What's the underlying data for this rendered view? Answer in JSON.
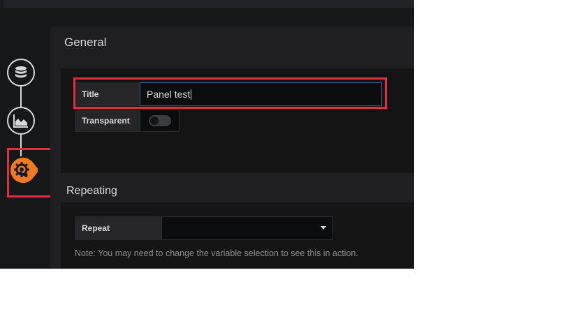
{
  "general": {
    "title": "General",
    "title_label": "Title",
    "title_value": "Panel test",
    "transparent_label": "Transparent",
    "transparent_on": false
  },
  "repeating": {
    "title": "Repeating",
    "repeat_label": "Repeat",
    "repeat_value": "",
    "note": "Note: You may need to change the variable selection to see this in action."
  },
  "steps": [
    {
      "icon": "database-icon",
      "active": false
    },
    {
      "icon": "area-chart-icon",
      "active": false
    },
    {
      "icon": "settings-wrench-icon",
      "active": true
    }
  ],
  "colors": {
    "background": "#161719",
    "panel": "#1f1f22",
    "active_step": "#f07a1d",
    "highlight": "#e02f38"
  }
}
